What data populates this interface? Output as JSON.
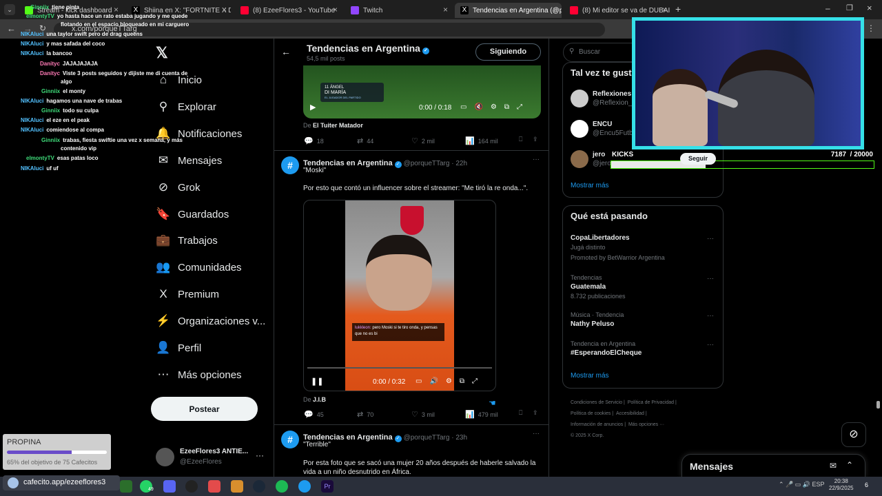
{
  "browser": {
    "tabs": [
      {
        "label": "Stream - kick dashboard",
        "color": "#53fc18"
      },
      {
        "label": "Shiina en X: \"FORTNITE X DAFT",
        "color": "#ffffff"
      },
      {
        "label": "(8) EzeeFlores3 - YouTube",
        "color": "#ff0033"
      },
      {
        "label": "Twitch",
        "color": "#9146ff"
      },
      {
        "label": "Tendencias en Argentina (@por",
        "color": "#ffffff"
      },
      {
        "label": "(8) Mi editor se va de DUBAI",
        "color": "#ff0033"
      }
    ],
    "url": "x.com/porqueTTarg"
  },
  "chat": [
    {
      "user": "Ginniix",
      "text": "tiene pinta",
      "c": "g"
    },
    {
      "user": "elmontyTV",
      "text": "yo hasta hace un rato estaba jugando y me quede",
      "c": "g"
    },
    {
      "user": "",
      "text": "flotando en el espacio bloqueado en mi carguero",
      "c": ""
    },
    {
      "user": "NIKAluci",
      "text": "una taylor swift pero de drag queens",
      "c": "b"
    },
    {
      "user": "NIKAluci",
      "text": "y mas safada del coco",
      "c": "b"
    },
    {
      "user": "NIKAluci",
      "text": "la bancoo",
      "c": "b"
    },
    {
      "user": "Danityc",
      "text": "JAJAJAJAJA",
      "c": "p"
    },
    {
      "user": "Danityc",
      "text": "Viste 3 posts seguidos y dijiste me di cuenta de",
      "c": "p"
    },
    {
      "user": "",
      "text": "algo",
      "c": ""
    },
    {
      "user": "Ginniix",
      "text": "el monty",
      "c": "g"
    },
    {
      "user": "NIKAluci",
      "text": "hagamos una nave de trabas",
      "c": "b"
    },
    {
      "user": "Ginniix",
      "text": "todo su culpa",
      "c": "g"
    },
    {
      "user": "NIKAluci",
      "text": "el eze en el peak",
      "c": "b"
    },
    {
      "user": "NIKAluci",
      "text": "comiendose al compa",
      "c": "b"
    },
    {
      "user": "Ginniix",
      "text": "trabas, fiesta swiftie una vez x semana, y más",
      "c": "g"
    },
    {
      "user": "",
      "text": "contenido vip",
      "c": ""
    },
    {
      "user": "elmontyTV",
      "text": "esas patas loco",
      "c": "g"
    },
    {
      "user": "NIKAluci",
      "text": "uf uf",
      "c": "b"
    }
  ],
  "sidebar": {
    "items": [
      {
        "label": "Inicio",
        "icon": "⌂"
      },
      {
        "label": "Explorar",
        "icon": "⚲"
      },
      {
        "label": "Notificaciones",
        "icon": "🔔"
      },
      {
        "label": "Mensajes",
        "icon": "✉"
      },
      {
        "label": "Grok",
        "icon": "⊘"
      },
      {
        "label": "Guardados",
        "icon": "🔖"
      },
      {
        "label": "Trabajos",
        "icon": "💼"
      },
      {
        "label": "Comunidades",
        "icon": "👥"
      },
      {
        "label": "Premium",
        "icon": "X"
      },
      {
        "label": "Organizaciones v...",
        "icon": "⚡"
      },
      {
        "label": "Perfil",
        "icon": "👤"
      },
      {
        "label": "Más opciones",
        "icon": "⋯"
      }
    ],
    "post_button": "Postear",
    "account_name": "EzeeFlores3 ANTIE...",
    "account_handle": "@EzeeFlores"
  },
  "header": {
    "title": "Tendencias en Argentina",
    "subtitle": "54,5 mil posts",
    "follow_button": "Siguiendo"
  },
  "tweet0": {
    "video_time": "0:00 / 0:18",
    "video_caption_1": "11 ÁNGEL",
    "video_caption_2": "DI MARÍA",
    "video_caption_3": "EL JUGADOR DEL PARTIDO",
    "from_prefix": "De",
    "from": "El Tuiter Matador",
    "replies": "18",
    "retweets": "44",
    "likes": "2 mil",
    "views": "164 mil"
  },
  "tweet1": {
    "name": "Tendencias en Argentina",
    "handle": "@porqueTTarg · 22h",
    "line1": "\"Moski\"",
    "line2": "Por esto que contó un influencer sobre el streamer: \"Me tiró la re onda...\".",
    "video_time": "0:00 / 0:32",
    "overlay_user": "lukkleon:",
    "overlay_text": "pero Moski si te tiro onda, y pensas que no es bi",
    "from_prefix": "De",
    "from": "J.I.B",
    "replies": "45",
    "retweets": "70",
    "likes": "3 mil",
    "views": "479 mil"
  },
  "tweet2": {
    "name": "Tendencias en Argentina",
    "handle": "@porqueTTarg · 23h",
    "line1": "\"Terrible\"",
    "line2": "Por esta foto que se sacó una mujer 20 años después de haberle salvado la",
    "line3": "vida a un niño desnutrido en África."
  },
  "right": {
    "search_placeholder": "Buscar",
    "who_title": "Tal vez te gust",
    "who": [
      {
        "name": "Reflexiones",
        "handle": "@Reflexion_"
      },
      {
        "name": "ENCU",
        "handle": "@Encu5Futb"
      },
      {
        "name": "jero",
        "handle": "@jero"
      }
    ],
    "follow_label": "Seguir",
    "show_more": "Mostrar más",
    "happening_title": "Qué está pasando",
    "trends": [
      {
        "k": "",
        "v": "CopaLibertadores",
        "s": "Jugá distinto",
        "s2": "Promoted by BetWarrior Argentina"
      },
      {
        "k": "Tendencias",
        "v": "Guatemala",
        "s": "8.732 publicaciones",
        "s2": ""
      },
      {
        "k": "Música · Tendencia",
        "v": "Nathy Peluso",
        "s": "",
        "s2": ""
      },
      {
        "k": "Tendencia en Argentina",
        "v": "#EsperandoElCheque",
        "s": "",
        "s2": ""
      }
    ],
    "show_more_2": "Mostrar más",
    "footer": [
      "Condiciones de Servicio |",
      "Política de Privacidad |",
      "Política de cookies |",
      "Accesibilidad |",
      "Información de anuncios |",
      "Más opciones ···",
      "© 2025 X Corp."
    ],
    "messages": "Mensajes"
  },
  "overlay": {
    "kicks_label": "KICKS",
    "kicks_count": "7187  / 20000",
    "kicks_progress": 0.36,
    "propina_title": "PROPINA",
    "propina_text": "65% del objetivo de 75 Cafecitos",
    "propina_progress": 0.65,
    "cafecito": "cafecito.app/ezeeflores3"
  },
  "taskbar": {
    "lang": "ESP",
    "time": "20:38",
    "date": "22/9/2025",
    "badge": "49",
    "notif": "6"
  }
}
